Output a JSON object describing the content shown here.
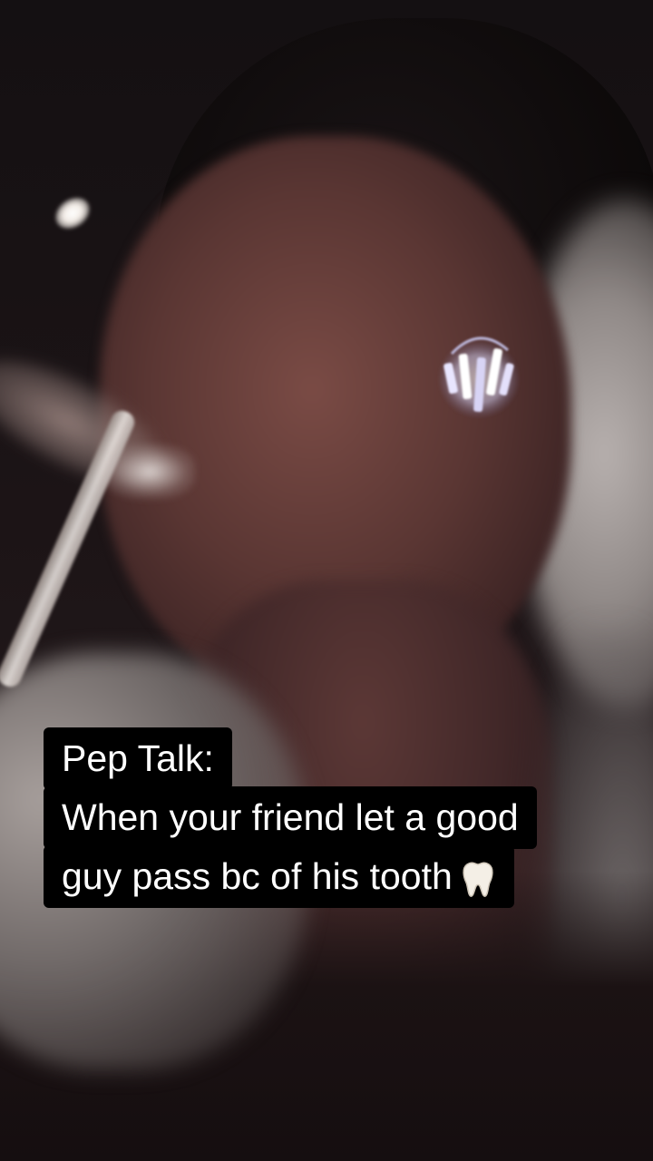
{
  "caption": {
    "line1": "Pep Talk:",
    "line2": "When your friend let a good",
    "line3": "guy pass bc of his tooth",
    "emoji_icon": "tooth-icon"
  },
  "colors": {
    "caption_background": "#000000",
    "caption_text": "#ffffff"
  }
}
